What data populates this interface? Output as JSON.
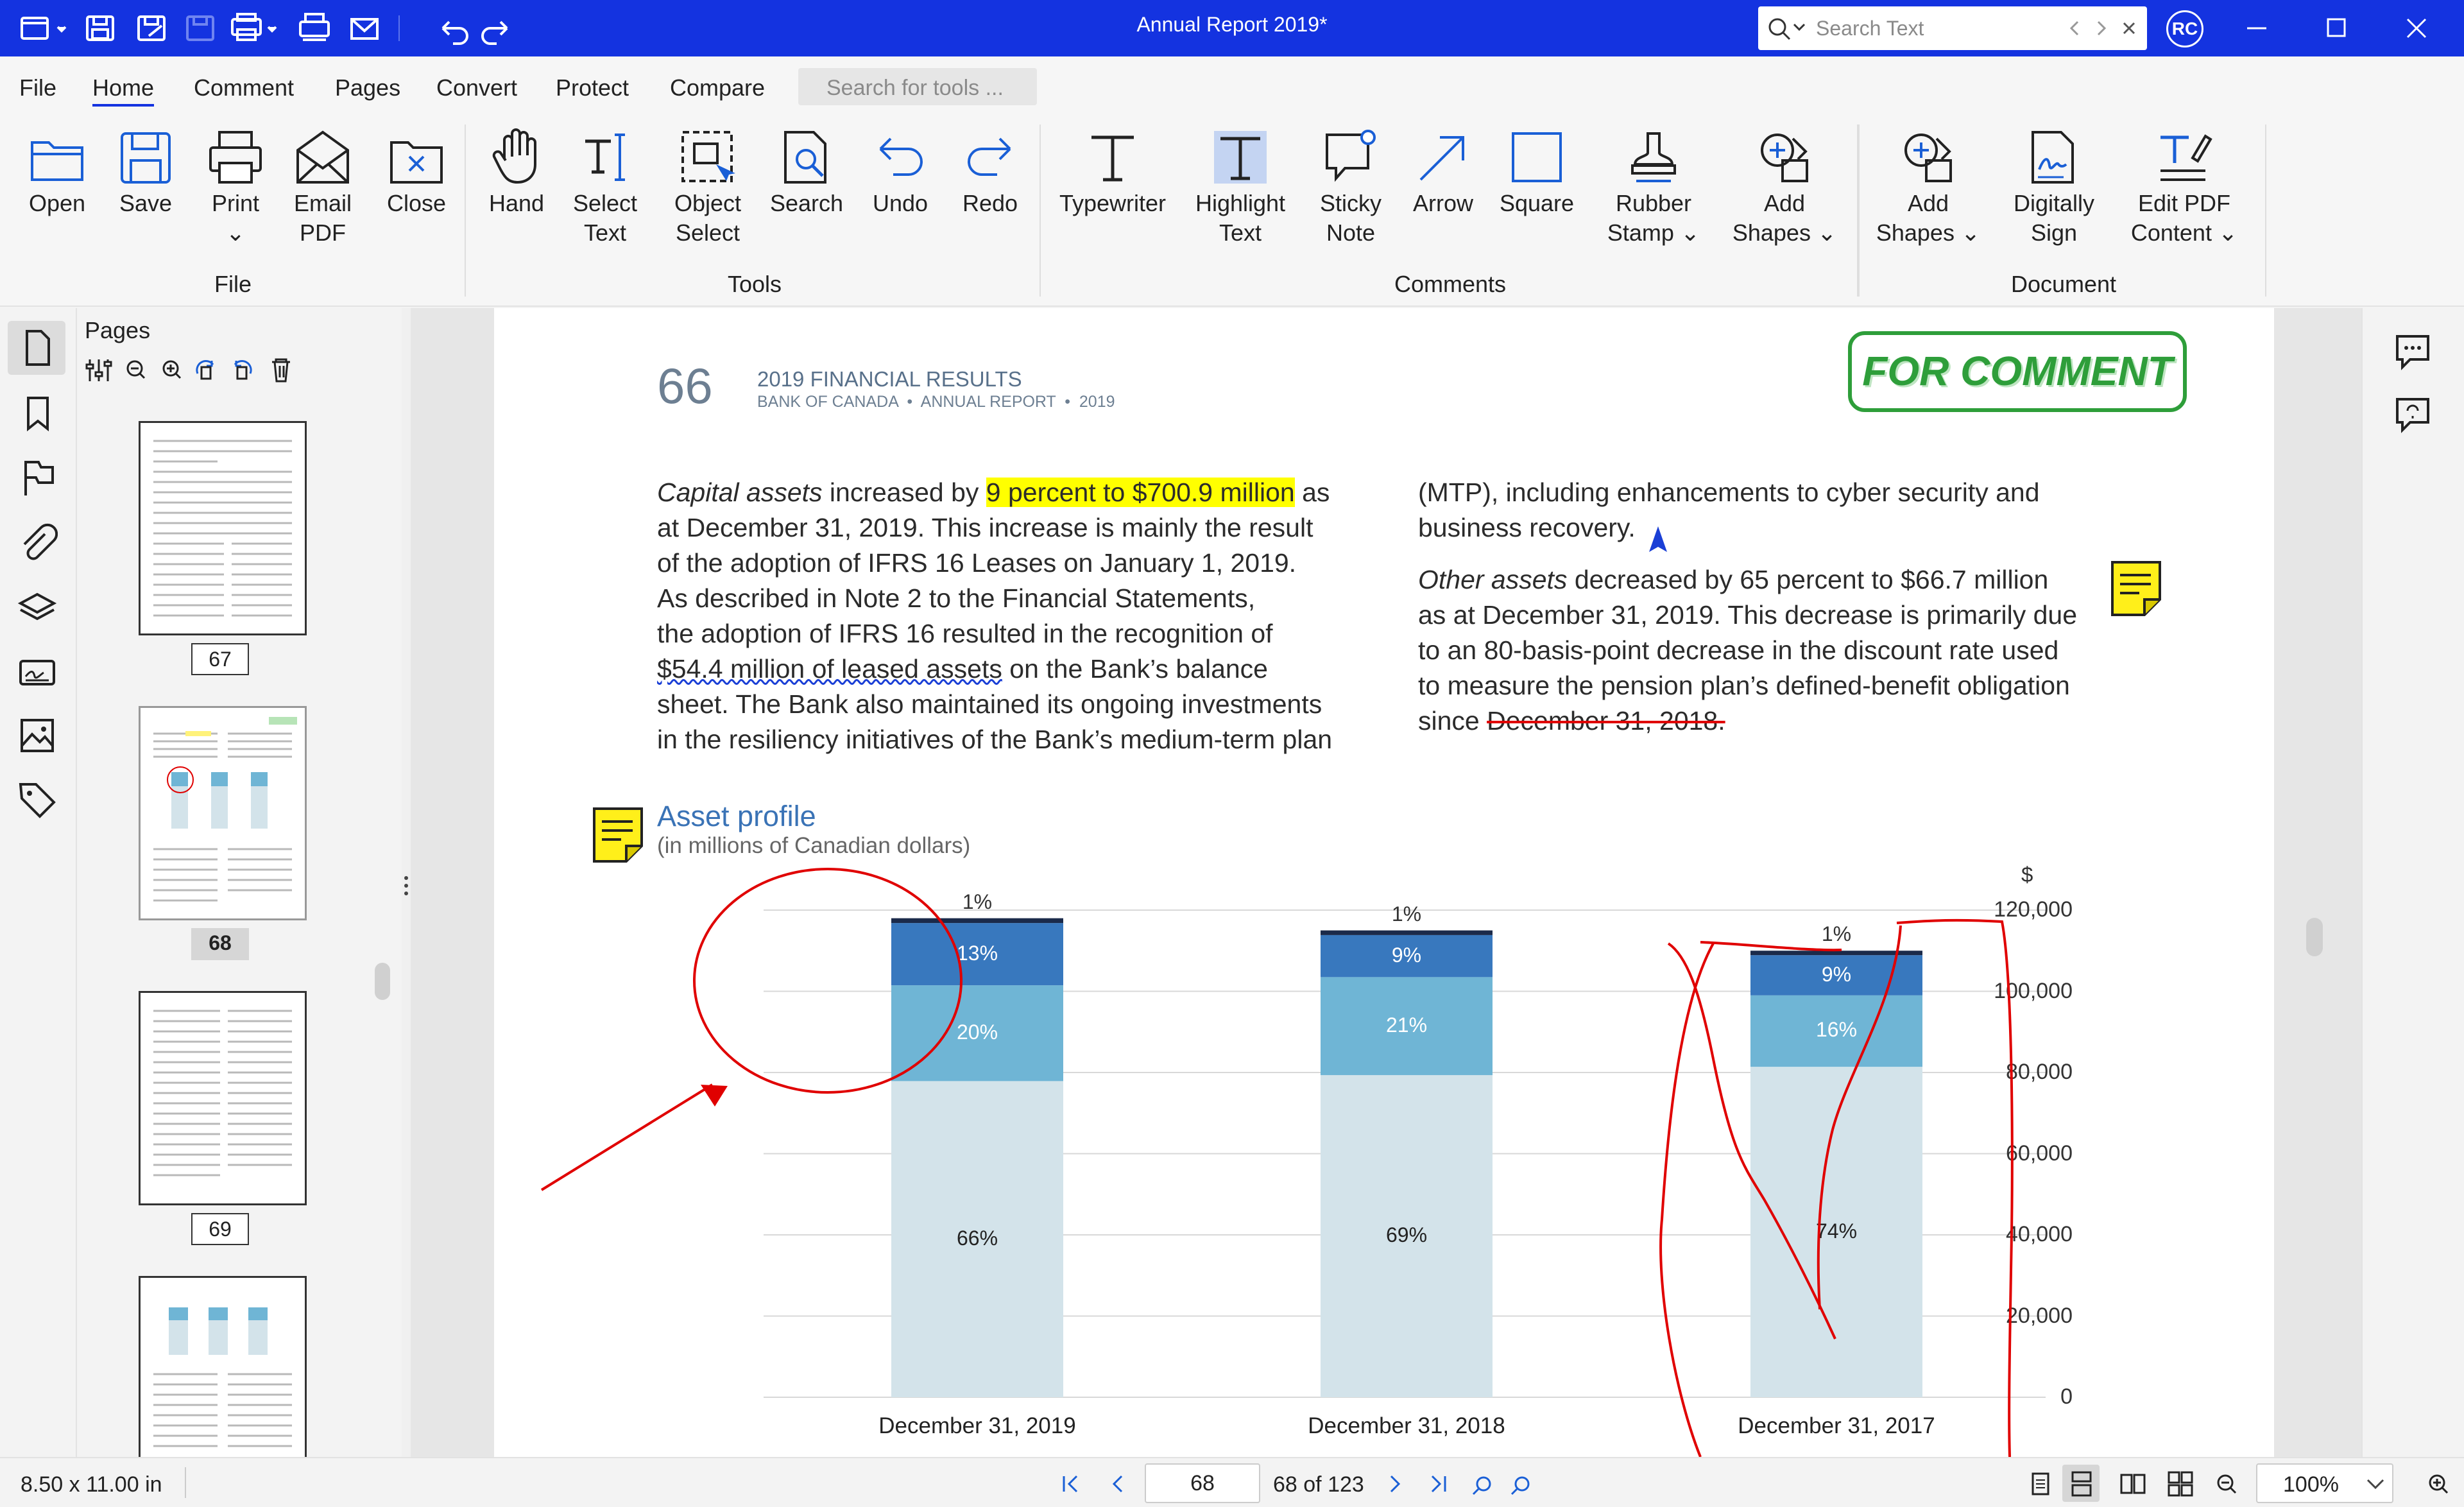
{
  "window": {
    "title": "Annual Report 2019*",
    "search_placeholder": "Search Text",
    "user_initials": "RC"
  },
  "menu": {
    "items": [
      "File",
      "Home",
      "Comment",
      "Pages",
      "Convert",
      "Protect",
      "Compare"
    ],
    "active": "Home",
    "tool_search_placeholder": "Search for tools ..."
  },
  "ribbon": {
    "file": {
      "label": "File",
      "buttons": [
        {
          "l1": "Open",
          "l2": "",
          "icon": "open-folder-icon"
        },
        {
          "l1": "Save",
          "l2": "",
          "icon": "save-icon"
        },
        {
          "l1": "Print",
          "l2": "⌄",
          "icon": "print-icon"
        },
        {
          "l1": "Email",
          "l2": "PDF",
          "icon": "email-icon"
        },
        {
          "l1": "Close",
          "l2": "",
          "icon": "close-doc-icon"
        }
      ]
    },
    "tools": {
      "label": "Tools",
      "buttons": [
        {
          "l1": "Hand",
          "l2": "",
          "icon": "hand-icon"
        },
        {
          "l1": "Select",
          "l2": "Text",
          "icon": "select-text-icon"
        },
        {
          "l1": "Object",
          "l2": "Select",
          "icon": "object-select-icon"
        },
        {
          "l1": "Search",
          "l2": "",
          "icon": "search-doc-icon"
        },
        {
          "l1": "Undo",
          "l2": "",
          "icon": "undo-icon"
        },
        {
          "l1": "Redo",
          "l2": "",
          "icon": "redo-icon"
        }
      ]
    },
    "comments": {
      "label": "Comments",
      "buttons": [
        {
          "l1": "Typewriter",
          "l2": "",
          "icon": "typewriter-icon"
        },
        {
          "l1": "Highlight",
          "l2": "Text",
          "icon": "highlight-text-icon"
        },
        {
          "l1": "Sticky",
          "l2": "Note",
          "icon": "sticky-note-icon"
        },
        {
          "l1": "Arrow",
          "l2": "",
          "icon": "arrow-icon"
        },
        {
          "l1": "Square",
          "l2": "",
          "icon": "square-icon"
        },
        {
          "l1": "Rubber",
          "l2": "Stamp ⌄",
          "icon": "rubber-stamp-icon"
        },
        {
          "l1": "Add",
          "l2": "Shapes ⌄",
          "icon": "add-shapes-icon"
        }
      ]
    },
    "document": {
      "label": "Document",
      "buttons": [
        {
          "l1": "Add",
          "l2": "Shapes ⌄",
          "icon": "add-shapes-icon"
        },
        {
          "l1": "Digitally",
          "l2": "Sign",
          "icon": "digital-sign-icon"
        },
        {
          "l1": "Edit PDF",
          "l2": "Content ⌄",
          "icon": "edit-pdf-icon"
        }
      ]
    }
  },
  "sidebar": {
    "title": "Pages",
    "pages": [
      "67",
      "68",
      "69"
    ],
    "selected": "68"
  },
  "page_content": {
    "page_number": "66",
    "header_title": "2019 FINANCIAL RESULTS",
    "header_sub": "BANK OF CANADA  •  ANNUAL REPORT  •  2019",
    "stamp": "FOR COMMENT",
    "col1": {
      "l1a": "Capital assets",
      "l1b": " increased by ",
      "l1c": "9 percent to $700.9 million",
      "l1d": " as",
      "l2": "at December 31, 2019. This increase is mainly the result",
      "l3": "of the adoption of IFRS 16 Leases on January 1, 2019.",
      "l4": "As described in Note 2 to the Financial Statements,",
      "l5": "the adoption of IFRS 16 resulted in the recognition of",
      "l6a": "$54.4 million of leased assets",
      "l6b": " on the Bank’s balance",
      "l7": "sheet. The Bank also maintained its ongoing investments",
      "l8": "in the resiliency initiatives of the Bank’s medium-term plan"
    },
    "col2": {
      "l1": "(MTP), including enhancements to cyber security and",
      "l2": "business recovery.",
      "l3a": "Other assets",
      "l3b": " decreased by 65 percent to $66.7 million",
      "l4": "as at December 31, 2019. This decrease is primarily due",
      "l5": "to an 80-basis-point decrease in the discount rate used",
      "l6": "to measure the pension plan’s defined-benefit obligation",
      "l7a": "since ",
      "l7b": "December 31, 2018."
    },
    "chart_title": "Asset profile",
    "chart_subtitle": "(in millions of Canadian dollars)"
  },
  "chart_data": {
    "type": "bar",
    "stacked": true,
    "title": "Asset profile",
    "subtitle": "(in millions of Canadian dollars)",
    "ylabel": "$",
    "ylim": [
      0,
      120000
    ],
    "yticks": [
      "0",
      "20,000",
      "40,000",
      "60,000",
      "80,000",
      "100,000",
      "120,000"
    ],
    "categories": [
      "December 31, 2019",
      "December 31, 2018",
      "December 31, 2017"
    ],
    "totals": [
      118000,
      115000,
      110000
    ],
    "series": [
      {
        "values_pct": [
          66,
          69,
          74
        ],
        "labels": [
          "66%",
          "69%",
          "74%"
        ],
        "color": "#d3e3ea"
      },
      {
        "values_pct": [
          20,
          21,
          16
        ],
        "labels": [
          "20%",
          "21%",
          "16%"
        ],
        "color": "#6fb5d5"
      },
      {
        "values_pct": [
          13,
          9,
          9
        ],
        "labels": [
          "13%",
          "9%",
          "9%"
        ],
        "color": "#3878be"
      },
      {
        "values_pct": [
          1,
          1,
          1
        ],
        "labels": [
          "1%",
          "1%",
          "1%"
        ],
        "color": "#1b2a4a"
      }
    ]
  },
  "status": {
    "page_size": "8.50 x 11.00 in",
    "page_input": "68",
    "page_of": "68 of 123",
    "zoom": "100%"
  },
  "colors": {
    "titlebar": "#1433e0",
    "accent": "#1433e0",
    "highlight": "#ffff00",
    "markup_red": "#e00000",
    "sticky": "#ffef1a",
    "stamp_green": "#2e9e3a"
  }
}
